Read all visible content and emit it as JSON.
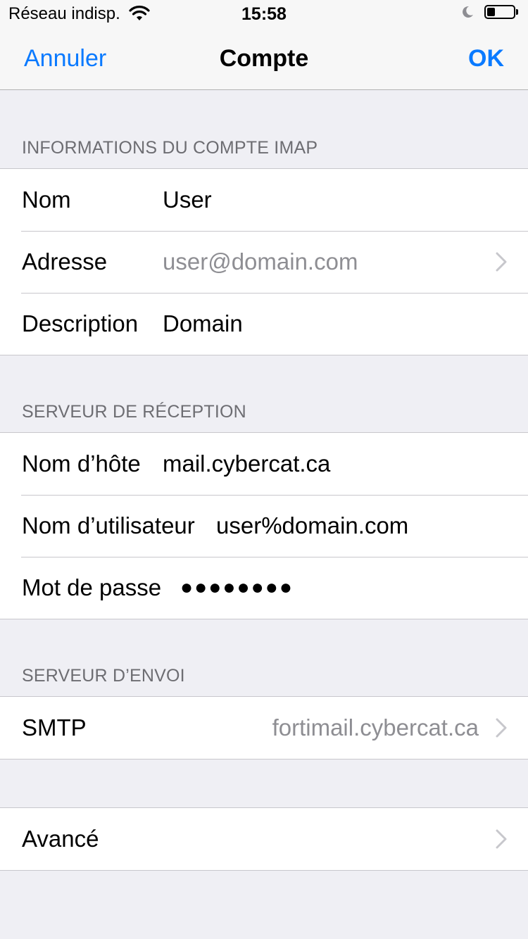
{
  "status_bar": {
    "carrier": "Réseau indisp.",
    "time": "15:58",
    "battery_level": 0.3,
    "wifi_icon": "wifi-icon",
    "moon_icon": "do-not-disturb-icon"
  },
  "nav": {
    "cancel_label": "Annuler",
    "title": "Compte",
    "done_label": "OK"
  },
  "imap_section": {
    "header": "INFORMATIONS DU COMPTE IMAP",
    "name_label": "Nom",
    "name_value": "User",
    "address_label": "Adresse",
    "address_value": "user@domain.com",
    "description_label": "Description",
    "description_value": "Domain"
  },
  "incoming_section": {
    "header": "SERVEUR DE RÉCEPTION",
    "host_label": "Nom d’hôte",
    "host_value": "mail.cybercat.ca",
    "username_label": "Nom d’utilisateur",
    "username_value": "user%domain.com",
    "password_label": "Mot de passe",
    "password_value": "●●●●●●●●"
  },
  "outgoing_section": {
    "header": "SERVEUR D’ENVOI",
    "smtp_label": "SMTP",
    "smtp_value": "fortimail.cybercat.ca"
  },
  "advanced": {
    "label": "Avancé"
  },
  "colors": {
    "accent": "#0a7aff",
    "background": "#efeff4",
    "secondary_text": "#8e8e93"
  }
}
